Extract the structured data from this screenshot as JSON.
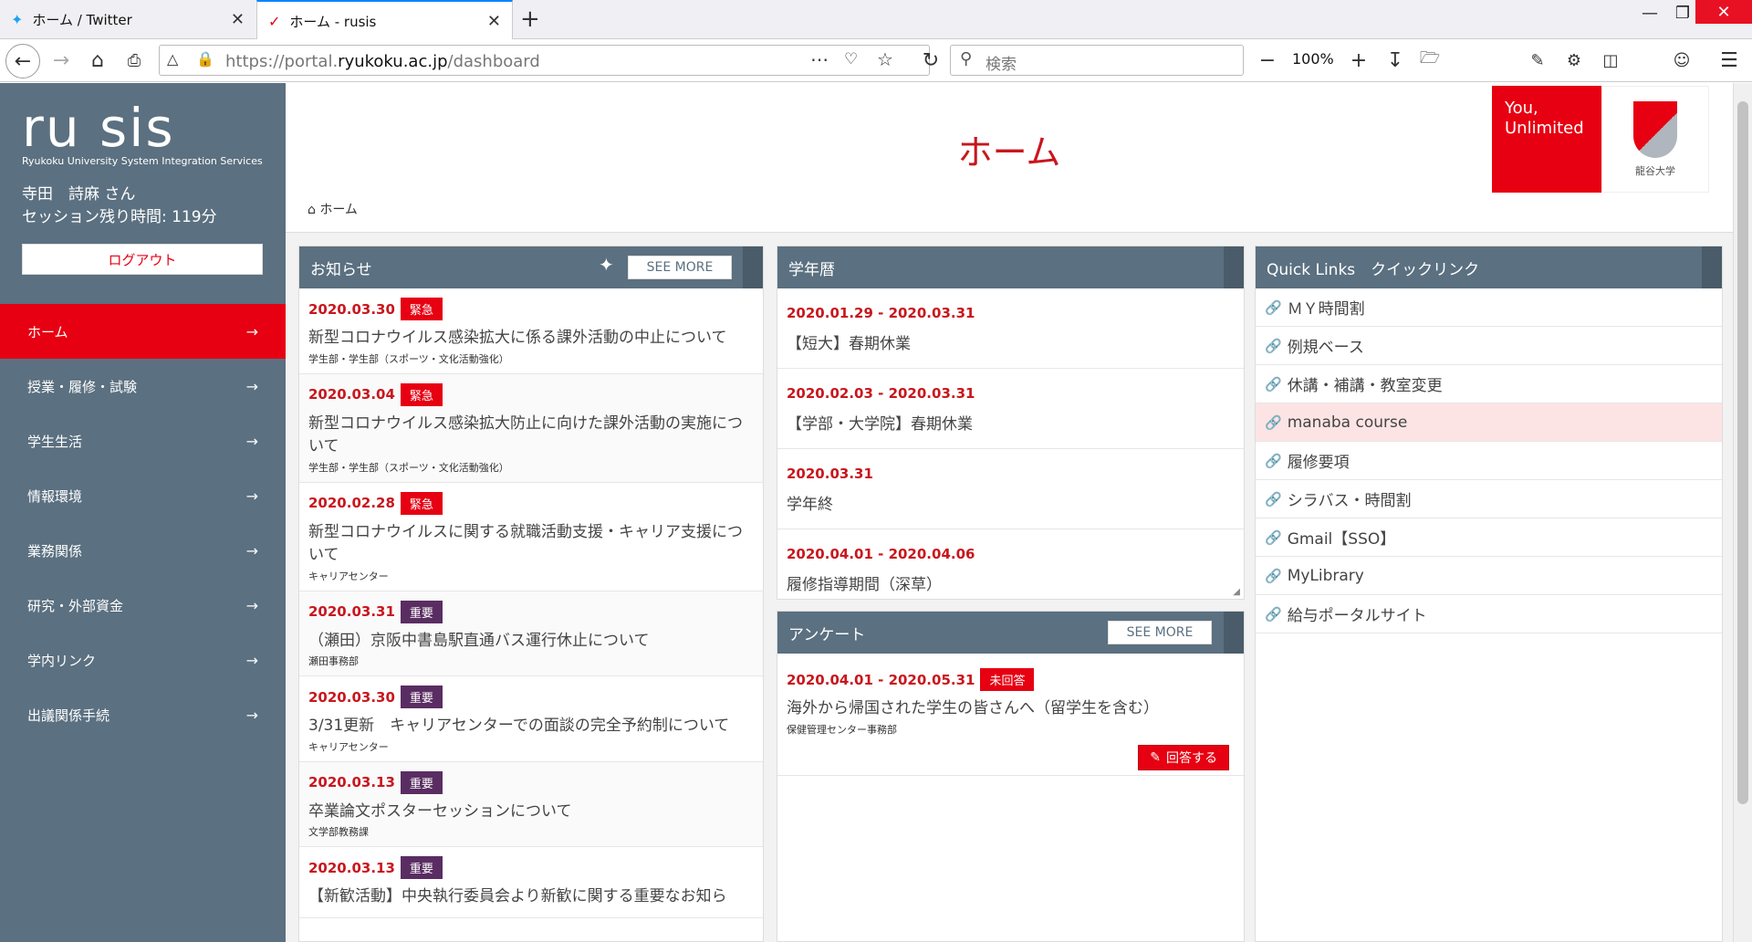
{
  "browser": {
    "tabs": [
      {
        "title": "ホーム / Twitter",
        "icon": "twitter-bird-icon"
      },
      {
        "title": "ホーム - rusis",
        "icon": "rusis-favicon-icon",
        "active": true
      }
    ],
    "url_prefix": "https://portal.",
    "url_domain": "ryukoku.ac.jp",
    "url_path": "/dashboard",
    "search_placeholder": "検索",
    "zoom": "100%"
  },
  "sidebar": {
    "logo": "ru sis",
    "logo_sub": "Ryukoku University System Integration Services",
    "user_name": "寺田　詩麻 さん",
    "session": "セッション残り時間: 119分",
    "logout_label": "ログアウト",
    "menu": [
      {
        "label": "ホーム",
        "active": true
      },
      {
        "label": "授業・履修・試験"
      },
      {
        "label": "学生生活"
      },
      {
        "label": "情報環境"
      },
      {
        "label": "業務関係"
      },
      {
        "label": "研究・外部資金"
      },
      {
        "label": "学内リンク"
      },
      {
        "label": "出議関係手続"
      }
    ]
  },
  "header": {
    "title": "ホーム",
    "brand_text": "You,\nUnlimited",
    "crest_text": "龍谷大学",
    "breadcrumb": "ホーム"
  },
  "notices": {
    "title": "お知らせ",
    "see_more": "SEE MORE",
    "items": [
      {
        "date": "2020.03.30",
        "badge": "緊急",
        "level": "urgent",
        "title": "新型コロナウイルス感染拡大に係る課外活動の中止について",
        "dept": "学生部・学生部（スポーツ・文化活動強化）"
      },
      {
        "date": "2020.03.04",
        "badge": "緊急",
        "level": "urgent",
        "title": "新型コロナウイルス感染拡大防止に向けた課外活動の実施について",
        "dept": "学生部・学生部（スポーツ・文化活動強化）"
      },
      {
        "date": "2020.02.28",
        "badge": "緊急",
        "level": "urgent",
        "title": "新型コロナウイルスに関する就職活動支援・キャリア支援について",
        "dept": "キャリアセンター"
      },
      {
        "date": "2020.03.31",
        "badge": "重要",
        "level": "important",
        "title": "（瀬田）京阪中書島駅直通バス運行休止について",
        "dept": "瀬田事務部"
      },
      {
        "date": "2020.03.30",
        "badge": "重要",
        "level": "important",
        "title": "3/31更新　キャリアセンターでの面談の完全予約制について",
        "dept": "キャリアセンター"
      },
      {
        "date": "2020.03.13",
        "badge": "重要",
        "level": "important",
        "title": "卒業論文ポスターセッションについて",
        "dept": "文学部教務課"
      },
      {
        "date": "2020.03.13",
        "badge": "重要",
        "level": "important",
        "title": "【新歓活動】中央執行委員会より新歓に関する重要なお知ら",
        "dept": ""
      }
    ]
  },
  "calendar": {
    "title": "学年暦",
    "items": [
      {
        "date": "2020.01.29 - 2020.03.31",
        "text": "【短大】春期休業"
      },
      {
        "date": "2020.02.03 - 2020.03.31",
        "text": "【学部・大学院】春期休業"
      },
      {
        "date": "2020.03.31",
        "text": "学年終"
      },
      {
        "date": "2020.04.01 - 2020.04.06",
        "text": "履修指導期間（深草）"
      }
    ]
  },
  "survey": {
    "title": "アンケート",
    "see_more": "SEE MORE",
    "date": "2020.04.01 - 2020.05.31",
    "badge": "未回答",
    "text": "海外から帰国された学生の皆さんへ（留学生を含む）",
    "dept": "保健管理センター事務部",
    "answer_label": "回答する"
  },
  "quicklinks": {
    "title": "Quick Links　クイックリンク",
    "items": [
      {
        "label": "ＭＹ時間割"
      },
      {
        "label": "例規ベース"
      },
      {
        "label": "休講・補講・教室変更"
      },
      {
        "label": "manaba course",
        "highlight": true
      },
      {
        "label": "履修要項"
      },
      {
        "label": "シラバス・時間割"
      },
      {
        "label": "Gmail【SSO】"
      },
      {
        "label": "MyLibrary"
      },
      {
        "label": "給与ポータルサイト"
      }
    ]
  },
  "colors": {
    "brand_red": "#e60012",
    "sidebar_slate": "#5b7080",
    "important_purple": "#5a2d62",
    "date_red": "#c9161d"
  }
}
